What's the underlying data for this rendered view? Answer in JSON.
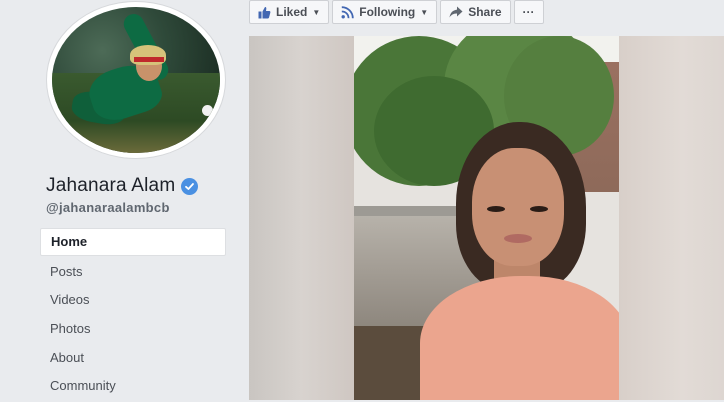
{
  "profile": {
    "name": "Jahanara Alam",
    "username": "@jahanaraalambcb",
    "verified_icon": "verified-badge-icon",
    "colors": {
      "verified": "#4a90e2"
    }
  },
  "nav": {
    "items": [
      {
        "label": "Home",
        "active": true
      },
      {
        "label": "Posts",
        "active": false
      },
      {
        "label": "Videos",
        "active": false
      },
      {
        "label": "Photos",
        "active": false
      },
      {
        "label": "About",
        "active": false
      },
      {
        "label": "Community",
        "active": false
      }
    ]
  },
  "actions": {
    "liked_label": "Liked",
    "following_label": "Following",
    "share_label": "Share",
    "more_label": "···",
    "icons": {
      "liked": "thumbs-up-icon",
      "following": "rss-icon",
      "share": "share-arrow-icon"
    },
    "colors": {
      "accent": "#4267b2",
      "text": "#4b4f56"
    }
  }
}
